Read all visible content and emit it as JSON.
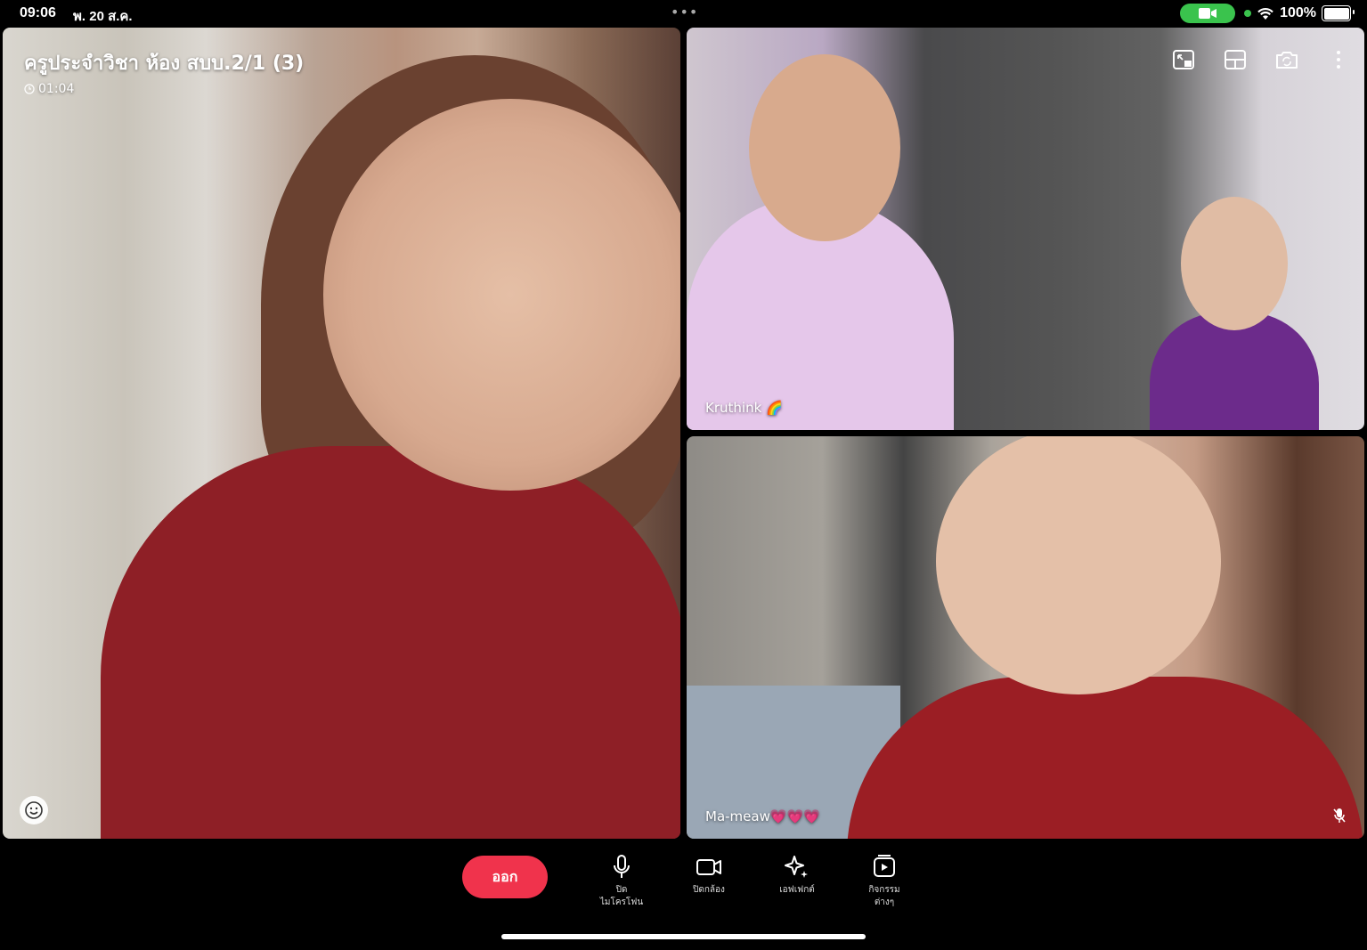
{
  "status_bar": {
    "time": "09:06",
    "date": "พ. 20 ส.ค.",
    "battery_percent": "100%"
  },
  "meeting": {
    "title": "ครูประจำวิชา ห้อง สบบ.2/1 (3)",
    "duration": "01:04"
  },
  "participants": [
    {
      "name": "Kruthink 🌈"
    },
    {
      "name": "Ma-meaw💗💗💗"
    }
  ],
  "controls": {
    "leave": "ออก",
    "mic": "ปิด\nไมโครโฟน",
    "camera": "ปิดกล้อง",
    "effects": "เอฟเฟกต์",
    "activities": "กิจกรรม\nต่างๆ"
  },
  "colors": {
    "leave_button": "#f0334c",
    "camera_indicator": "#3ac34d"
  }
}
